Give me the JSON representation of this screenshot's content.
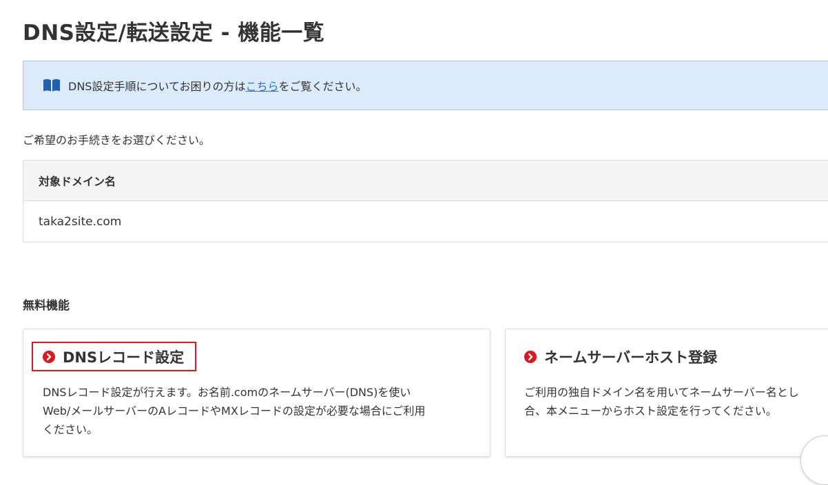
{
  "page": {
    "title": "DNS設定/転送設定 - 機能一覧"
  },
  "info": {
    "icon": "book-icon",
    "text_before": "DNS設定手順についてお困りの方は",
    "link_text": "こちら",
    "text_after": "をご覧ください。"
  },
  "instruction": "ご希望のお手続きをお選びください。",
  "domain_table": {
    "header": "対象ドメイン名",
    "value": "taka2site.com"
  },
  "section": {
    "title": "無料機能"
  },
  "cards": [
    {
      "title": "DNSレコード設定",
      "icon": "circle-chevron-right-icon",
      "desc_lines": [
        "DNSレコード設定が行えます。お名前.comのネームサーバー(DNS)を使い",
        "Web/メールサーバーのAレコードやMXレコードの設定が必要な場合にご利用",
        "ください。"
      ]
    },
    {
      "title": "ネームサーバーホスト登録",
      "icon": "circle-chevron-right-icon",
      "desc_lines": [
        "ご利用の独自ドメイン名を用いてネームサーバー名とし",
        "合、本メニューからホスト設定を行ってください。"
      ]
    }
  ],
  "colors": {
    "accent_red": "#e0161e",
    "info_bg": "#dcebfc",
    "link_blue": "#2f6fd0"
  }
}
